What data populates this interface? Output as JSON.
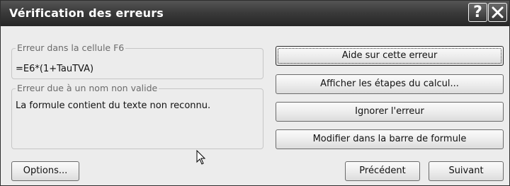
{
  "window": {
    "title": "Vérification des erreurs",
    "help_glyph": "?",
    "close_icon": "close-icon"
  },
  "error_location": {
    "label": "Erreur dans la cellule F6",
    "formula": "=E6*(1+TauTVA)"
  },
  "error_description": {
    "label": "Erreur due à un nom non valide",
    "text": "La formule contient du texte non reconnu."
  },
  "actions": {
    "help_on_error": "Aide sur cette erreur",
    "show_calc_steps": "Afficher les étapes du calcul...",
    "ignore_error": "Ignorer l'erreur",
    "edit_in_formula_bar": "Modifier dans la barre de formule"
  },
  "footer": {
    "options": "Options...",
    "previous": "Précédent",
    "next": "Suivant"
  },
  "colors": {
    "titlebar": "#3b3b3b",
    "dialog_background": "#ececec"
  }
}
